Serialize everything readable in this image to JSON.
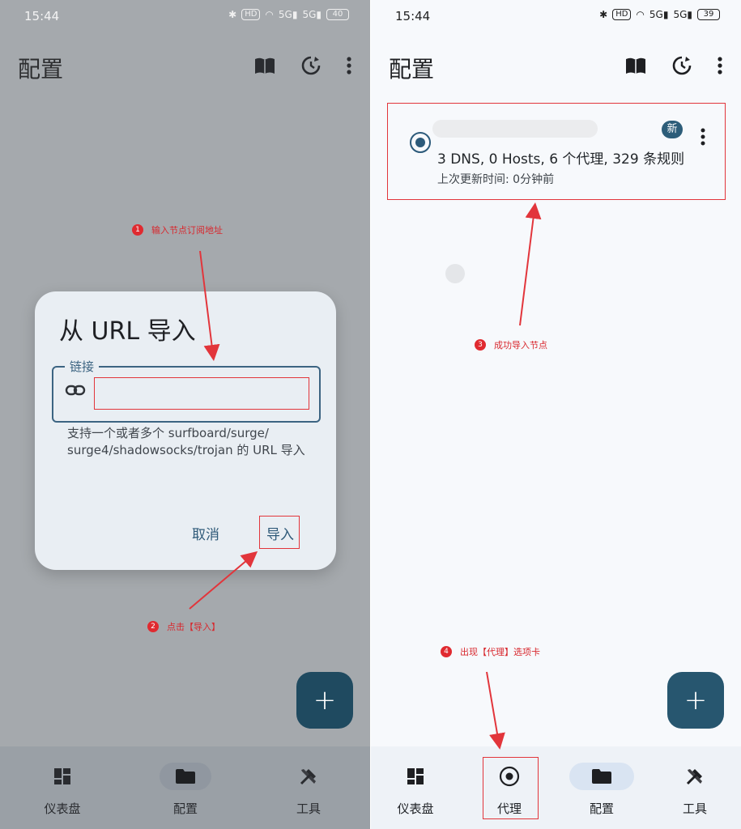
{
  "colors": {
    "accent": "#2c5a7a",
    "annotation_red": "#e2353b",
    "fab": "#27566f"
  },
  "left": {
    "status": {
      "time": "15:44",
      "hd": "HD",
      "net1": "5G",
      "net2": "5G",
      "battery": "40"
    },
    "title": "配置",
    "dialog": {
      "title": "从 URL 导入",
      "field_label": "链接",
      "field_value": "",
      "helper": "支持一个或者多个 surfboard/surge/ surge4/shadowsocks/trojan 的 URL 导入",
      "cancel": "取消",
      "confirm": "导入"
    },
    "fab": "+",
    "nav": [
      {
        "label": "仪表盘",
        "icon": "dashboard-icon"
      },
      {
        "label": "配置",
        "icon": "folder-icon"
      },
      {
        "label": "工具",
        "icon": "tools-icon"
      }
    ],
    "annotations": [
      {
        "num": "1",
        "text": "输入节点订阅地址"
      },
      {
        "num": "2",
        "text": "点击【导入】"
      }
    ]
  },
  "right": {
    "status": {
      "time": "15:44",
      "hd": "HD",
      "net1": "5G",
      "net2": "5G",
      "battery": "39"
    },
    "title": "配置",
    "card": {
      "badge": "新",
      "stats": "3 DNS, 0 Hosts, 6 个代理, 329 条规则",
      "updated": "上次更新时间: 0分钟前"
    },
    "fab": "+",
    "nav": [
      {
        "label": "仪表盘",
        "icon": "dashboard-icon"
      },
      {
        "label": "代理",
        "icon": "proxy-icon"
      },
      {
        "label": "配置",
        "icon": "folder-icon"
      },
      {
        "label": "工具",
        "icon": "tools-icon"
      }
    ],
    "annotations": [
      {
        "num": "3",
        "text": "成功导入节点"
      },
      {
        "num": "4",
        "text": "出现【代理】选项卡"
      }
    ]
  }
}
